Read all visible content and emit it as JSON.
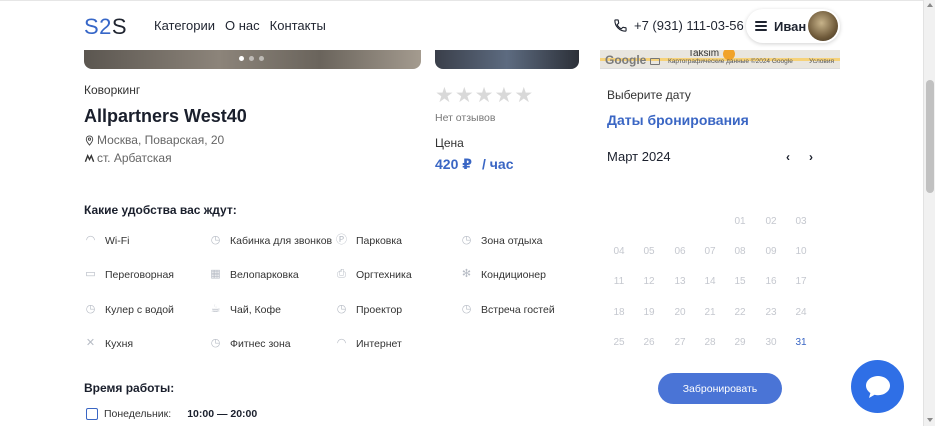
{
  "header": {
    "logo_a": "S2",
    "logo_b": "S",
    "nav": [
      "Категории",
      "О нас",
      "Контакты"
    ],
    "phone": "+7 (931) 111-03-56",
    "user_name": "Иван"
  },
  "map": {
    "place": "Taksim",
    "google": "Google",
    "map_data": "Картографические данные ©2024 Google",
    "terms": "Условия"
  },
  "venue": {
    "type": "Коворкинг",
    "title": "Allpartners West40",
    "address": "Москва, Поварская, 20",
    "metro": "ст. Арбатская"
  },
  "rating": {
    "stars": "★★★★★",
    "no_reviews": "Нет отзывов",
    "price_label": "Цена",
    "price": "420 ₽",
    "price_unit": "/ час"
  },
  "amenities": {
    "title": "Какие удобства вас ждут:",
    "items": [
      {
        "label": "Wi-Fi",
        "icon": "wifi-icon"
      },
      {
        "label": "Кабинка для звонков",
        "icon": "clock-icon"
      },
      {
        "label": "Парковка",
        "icon": "parking-icon"
      },
      {
        "label": "Зона отдыха",
        "icon": "clock-icon"
      },
      {
        "label": "Переговорная",
        "icon": "chat-bubble-icon"
      },
      {
        "label": "Велопарковка",
        "icon": "bike-icon"
      },
      {
        "label": "Оргтехника",
        "icon": "printer-icon"
      },
      {
        "label": "Кондиционер",
        "icon": "snowflake-icon"
      },
      {
        "label": "Кулер с водой",
        "icon": "clock-icon"
      },
      {
        "label": "Чай, Кофе",
        "icon": "cup-icon"
      },
      {
        "label": "Проектор",
        "icon": "clock-icon"
      },
      {
        "label": "Встреча гостей",
        "icon": "clock-icon"
      },
      {
        "label": "Кухня",
        "icon": "utensils-icon"
      },
      {
        "label": "Фитнес зона",
        "icon": "clock-icon"
      },
      {
        "label": "Интернет",
        "icon": "wifi-icon"
      }
    ]
  },
  "hours": {
    "title": "Время работы:",
    "day": "Понедельник:",
    "time": "10:00 — 20:00"
  },
  "booking": {
    "choose_date": "Выберите дату",
    "dates_link": "Даты бронирования",
    "month": "Март 2024",
    "prev": "‹",
    "next": "›",
    "days": [
      "01",
      "02",
      "03",
      "04",
      "05",
      "06",
      "07",
      "08",
      "09",
      "10",
      "11",
      "12",
      "13",
      "14",
      "15",
      "16",
      "17",
      "18",
      "19",
      "20",
      "21",
      "22",
      "23",
      "24",
      "25",
      "26",
      "27",
      "28",
      "29",
      "30",
      "31"
    ],
    "active_day": "31",
    "book_button": "Забронировать"
  },
  "colors": {
    "accent": "#3a66c4",
    "chat": "#2f6fe6"
  }
}
